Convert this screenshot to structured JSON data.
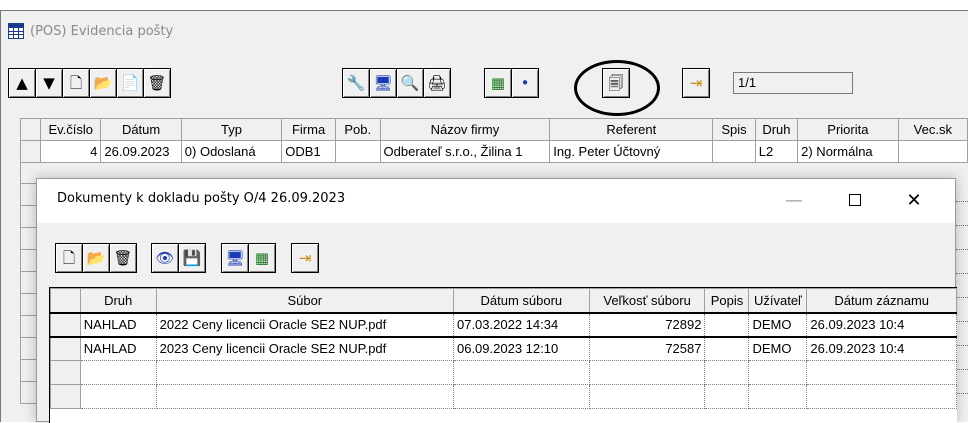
{
  "main_window": {
    "title": "(POS) Evidencia pošty",
    "page_indicator": "1/1",
    "toolbar": {
      "first": "▲",
      "last": "▼",
      "new": "🗋",
      "open": "📂",
      "copy": "📄",
      "delete": "🗑",
      "tools": "🔧",
      "monitor": "🖥",
      "search": "🔍",
      "print": "🖨",
      "export": "▦",
      "point": "•",
      "documents": "🗐",
      "exit": "⇥"
    },
    "grid": {
      "columns": [
        "Ev.číslo",
        "Dátum",
        "Typ",
        "Firma",
        "Pob.",
        "Názov firmy",
        "Referent",
        "Spis",
        "Druh",
        "Priorita",
        "Vec.sk"
      ],
      "rows": [
        [
          "4",
          "26.09.2023",
          "0) Odoslaná",
          "ODB1",
          "",
          "Odberateľ s.r.o., Žilina 1",
          "Ing. Peter Účtovný",
          "",
          "L2",
          "2) Normálna",
          ""
        ]
      ]
    }
  },
  "dialog": {
    "title": "Dokumenty k dokladu pošty O/4 26.09.2023",
    "controls": {
      "minimize": "—",
      "close": "✕"
    },
    "toolbar": {
      "new": "🗋",
      "open": "📂",
      "delete": "🗑",
      "view": "👁",
      "save": "💾",
      "monitor": "🖥",
      "export": "▦",
      "exit": "⇥"
    },
    "grid": {
      "columns": [
        "Druh",
        "Súbor",
        "Dátum súboru",
        "Veľkosť súboru",
        "Popis",
        "Užívateľ",
        "Dátum záznamu"
      ],
      "rows": [
        [
          "NAHLAD",
          "2022 Ceny licencii Oracle SE2  NUP.pdf",
          "07.03.2022 14:34",
          "72892",
          "",
          "DEMO",
          "26.09.2023 10:4"
        ],
        [
          "NAHLAD",
          "2023 Ceny licencii Oracle SE2  NUP.pdf",
          "06.09.2023 12:10",
          "72587",
          "",
          "DEMO",
          "26.09.2023 10:4"
        ]
      ]
    }
  }
}
